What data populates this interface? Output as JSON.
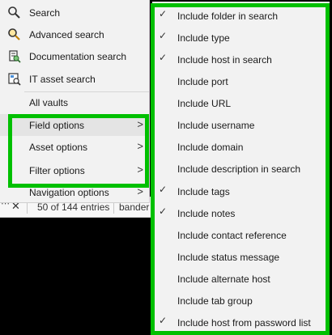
{
  "menu": {
    "items": [
      {
        "label": "Search",
        "icon": "magnifier-icon"
      },
      {
        "label": "Advanced search",
        "icon": "advanced-search-icon"
      },
      {
        "label": "Documentation search",
        "icon": "documentation-search-icon"
      },
      {
        "label": "IT asset search",
        "icon": "it-asset-search-icon"
      },
      {
        "label": "All vaults"
      },
      {
        "label": "Field options",
        "submenu": true,
        "highlighted": true
      },
      {
        "label": "Asset options",
        "submenu": true
      },
      {
        "label": "Filter options",
        "submenu": true
      },
      {
        "label": "Navigation options",
        "submenu": true
      }
    ],
    "submenu_arrow": ">"
  },
  "field_options": {
    "items": [
      {
        "label": "Include folder in search",
        "checked": true
      },
      {
        "label": "Include type",
        "checked": true
      },
      {
        "label": "Include host in search",
        "checked": true
      },
      {
        "label": "Include port",
        "checked": false
      },
      {
        "label": "Include URL",
        "checked": false
      },
      {
        "label": "Include username",
        "checked": false
      },
      {
        "label": "Include domain",
        "checked": false
      },
      {
        "label": "Include description in search",
        "checked": false
      },
      {
        "label": "Include tags",
        "checked": true
      },
      {
        "label": "Include notes",
        "checked": true
      },
      {
        "label": "Include contact reference",
        "checked": false
      },
      {
        "label": "Include status message",
        "checked": false
      },
      {
        "label": "Include alternate host",
        "checked": false
      },
      {
        "label": "Include tab group",
        "checked": false
      },
      {
        "label": "Include host from password list",
        "checked": true
      }
    ],
    "check_mark": "✓"
  },
  "background": {
    "overflow_glyph": "⋯",
    "close_glyph": "✕",
    "entries_text": "50 of 144 entries",
    "column_text": "bander"
  },
  "colors": {
    "highlight_box": "#00c000",
    "menu_background": "#f2f2f2"
  }
}
